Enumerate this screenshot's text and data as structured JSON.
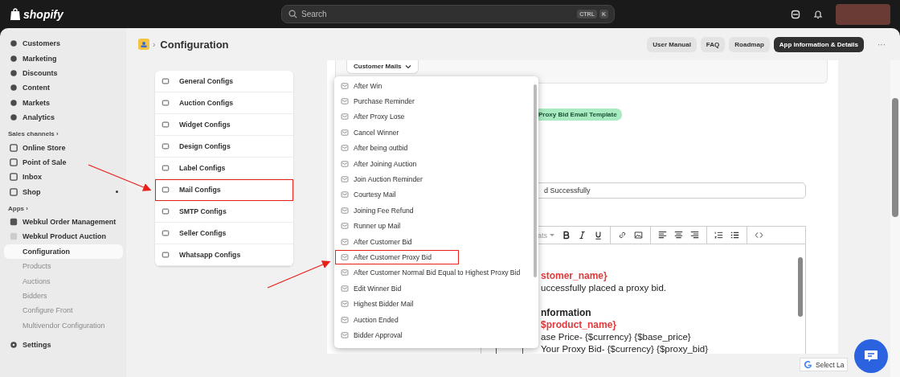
{
  "topbar": {
    "logo": "shopify",
    "search": {
      "placeholder": "Search",
      "keys": [
        "CTRL",
        "K"
      ]
    }
  },
  "sidebar": {
    "main": [
      {
        "label": "Customers"
      },
      {
        "label": "Marketing"
      },
      {
        "label": "Discounts"
      },
      {
        "label": "Content"
      },
      {
        "label": "Markets"
      },
      {
        "label": "Analytics"
      }
    ],
    "sales_channels": {
      "heading": "Sales channels",
      "chevron": "›",
      "items": [
        {
          "label": "Online Store",
          "dot": false
        },
        {
          "label": "Point of Sale",
          "dot": false
        },
        {
          "label": "Inbox",
          "dot": false
        },
        {
          "label": "Shop",
          "dot": true
        }
      ]
    },
    "apps": {
      "heading": "Apps",
      "chevron": "›",
      "items": [
        {
          "label": "Webkul Order Management"
        },
        {
          "label": "Webkul Product Auction"
        }
      ],
      "subitems": [
        {
          "label": "Configuration",
          "selected": true
        },
        {
          "label": "Products",
          "selected": false
        },
        {
          "label": "Auctions",
          "selected": false
        },
        {
          "label": "Bidders",
          "selected": false
        },
        {
          "label": "Configure Front",
          "selected": false
        },
        {
          "label": "Multivendor Configuration",
          "selected": false
        }
      ]
    },
    "settings": "Settings"
  },
  "header": {
    "separator": "›",
    "title": "Configuration",
    "buttons": [
      {
        "label": "User Manual",
        "primary": false
      },
      {
        "label": "FAQ",
        "primary": false
      },
      {
        "label": "Roadmap",
        "primary": false
      },
      {
        "label": "App Information & Details",
        "primary": true
      }
    ],
    "more": "···"
  },
  "config_menu": [
    {
      "label": "General Configs",
      "highlighted": false
    },
    {
      "label": "Auction Configs",
      "highlighted": false
    },
    {
      "label": "Widget Configs",
      "highlighted": false
    },
    {
      "label": "Design Configs",
      "highlighted": false
    },
    {
      "label": "Label Configs",
      "highlighted": false
    },
    {
      "label": "Mail Configs",
      "highlighted": true
    },
    {
      "label": "SMTP Configs",
      "highlighted": false
    },
    {
      "label": "Seller Configs",
      "highlighted": false
    },
    {
      "label": "Whatsapp Configs",
      "highlighted": false
    }
  ],
  "mail_dropdown": {
    "trigger": "Customer Mails",
    "options": [
      {
        "label": "After Win",
        "highlighted": false
      },
      {
        "label": "Purchase Reminder",
        "highlighted": false
      },
      {
        "label": "After Proxy Lose",
        "highlighted": false
      },
      {
        "label": "Cancel Winner",
        "highlighted": false
      },
      {
        "label": "After being outbid",
        "highlighted": false
      },
      {
        "label": "After Joining Auction",
        "highlighted": false
      },
      {
        "label": "Join Auction Reminder",
        "highlighted": false
      },
      {
        "label": "Courtesy Mail",
        "highlighted": false
      },
      {
        "label": "Joining Fee Refund",
        "highlighted": false
      },
      {
        "label": "Runner up Mail",
        "highlighted": false
      },
      {
        "label": "After Customer Bid",
        "highlighted": false
      },
      {
        "label": "After Customer Proxy Bid",
        "highlighted": true
      },
      {
        "label": "After Customer Normal Bid Equal to Highest Proxy Bid",
        "highlighted": false
      },
      {
        "label": "Edit Winner Bid",
        "highlighted": false
      },
      {
        "label": "Highest Bidder Mail",
        "highlighted": false
      },
      {
        "label": "Auction Ended",
        "highlighted": false
      },
      {
        "label": "Bidder Approval",
        "highlighted": false
      }
    ]
  },
  "template": {
    "badge": "Proxy Bid Email Template",
    "subject": "d Successfully",
    "format_menu": "ats",
    "editor_lines": [
      {
        "kind": "variable",
        "text": "stomer_name}"
      },
      {
        "kind": "text",
        "text": "uccessfully placed a proxy bid."
      },
      {
        "kind": "heading",
        "text": "nformation"
      },
      {
        "kind": "variable",
        "text": "$product_name}"
      },
      {
        "kind": "text",
        "text": "ase Price- {$currency} {$base_price}"
      },
      {
        "kind": "text",
        "text": "Your Proxy Bid- {$currency} {$proxy_bid}"
      }
    ]
  },
  "translate_widget": "Select La"
}
